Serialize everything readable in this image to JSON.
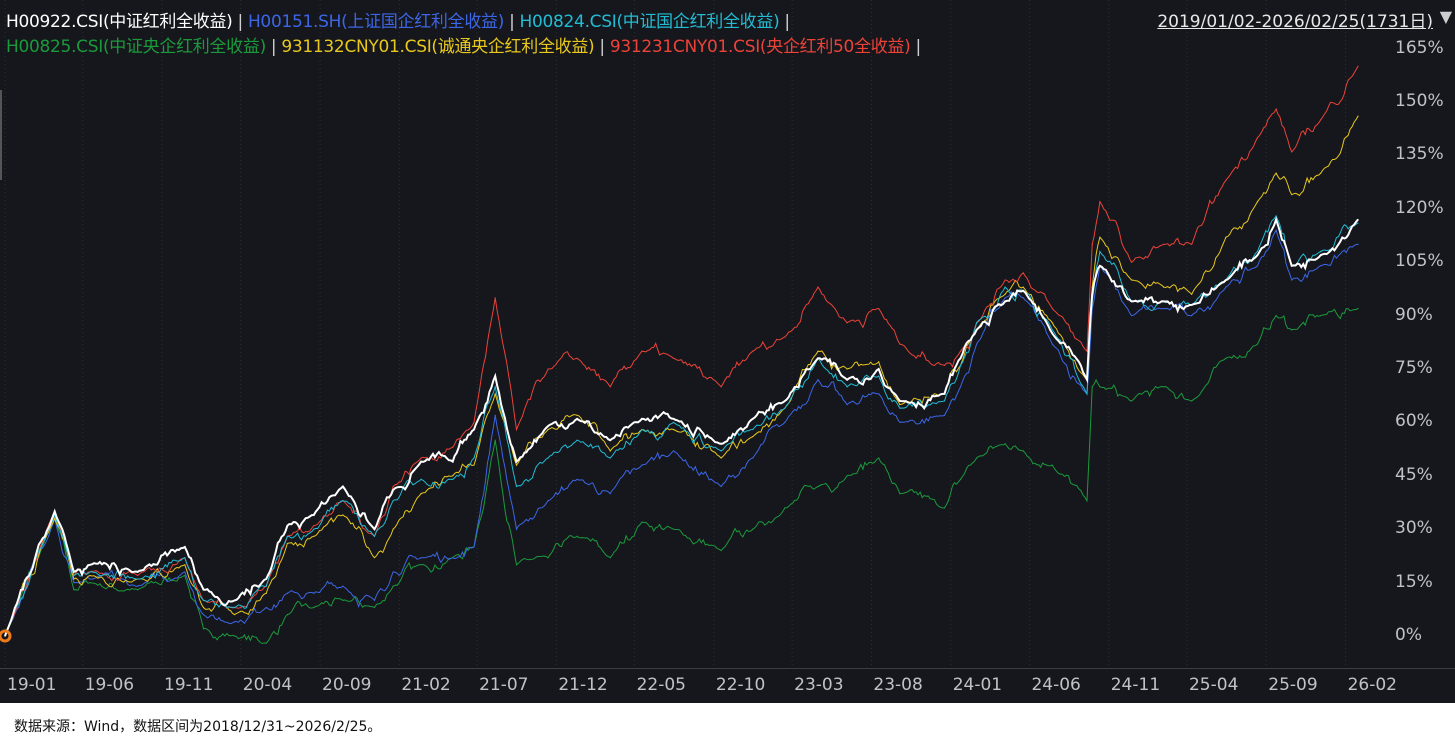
{
  "header": {
    "date_range": "2019/01/02-2026/02/25(1731日)",
    "separator": "|"
  },
  "footer": {
    "note": "数据来源：Wind，数据区间为2018/12/31~2026/2/25。"
  },
  "chart_data": {
    "type": "line",
    "title": "",
    "xlabel": "",
    "ylabel": "",
    "ylim": [
      -8,
      168
    ],
    "y_ticks": [
      "165%",
      "150%",
      "135%",
      "120%",
      "105%",
      "90%",
      "75%",
      "60%",
      "45%",
      "30%",
      "15%",
      "0%"
    ],
    "y_tick_values": [
      165,
      150,
      135,
      120,
      105,
      90,
      75,
      60,
      45,
      30,
      15,
      0
    ],
    "x_ticks": [
      "19-01",
      "19-06",
      "19-11",
      "20-04",
      "20-09",
      "21-02",
      "21-07",
      "21-12",
      "22-05",
      "22-10",
      "23-03",
      "23-08",
      "24-01",
      "24-06",
      "24-11",
      "25-04",
      "25-09",
      "26-02"
    ],
    "x_tick_dates": [
      "2019-01-02",
      "2019-06-01",
      "2019-11-01",
      "2020-04-01",
      "2020-09-01",
      "2021-02-01",
      "2021-07-01",
      "2021-12-01",
      "2022-05-01",
      "2022-10-01",
      "2023-03-01",
      "2023-08-01",
      "2024-01-01",
      "2024-06-01",
      "2024-11-01",
      "2025-04-01",
      "2025-09-01",
      "2026-02-01"
    ],
    "grid": false,
    "legend_position": "top-left",
    "x": [
      "2019-01-02",
      "2019-04-08",
      "2019-05-15",
      "2019-06-15",
      "2019-09-15",
      "2019-12-15",
      "2020-01-20",
      "2020-03-20",
      "2020-05-20",
      "2020-06-30",
      "2020-08-20",
      "2020-10-15",
      "2020-12-15",
      "2021-01-20",
      "2021-03-15",
      "2021-05-15",
      "2021-06-25",
      "2021-08-05",
      "2021-09-15",
      "2021-11-15",
      "2022-01-10",
      "2022-03-15",
      "2022-05-15",
      "2022-07-15",
      "2022-10-15",
      "2022-12-15",
      "2023-02-15",
      "2023-04-20",
      "2023-06-15",
      "2023-08-15",
      "2023-09-25",
      "2023-12-20",
      "2024-01-20",
      "2024-02-20",
      "2024-04-15",
      "2024-05-20",
      "2024-07-15",
      "2024-09-20",
      "2024-09-30",
      "2024-10-15",
      "2024-12-15",
      "2025-02-15",
      "2025-04-10",
      "2025-06-15",
      "2025-08-15",
      "2025-09-20",
      "2025-10-20",
      "2025-12-15",
      "2026-02-25"
    ],
    "series": [
      {
        "name": "H00825.CSI(中证央企红利全收益)",
        "color": "#1b9a3c",
        "line": 1,
        "values": [
          0,
          33,
          13,
          15,
          13,
          17,
          2,
          0,
          -2,
          6,
          8,
          10,
          8,
          14,
          20,
          22,
          25,
          55,
          20,
          22,
          28,
          22,
          32,
          30,
          24,
          30,
          36,
          42,
          45,
          50,
          40,
          36,
          44,
          50,
          54,
          52,
          48,
          38,
          70,
          70,
          66,
          70,
          66,
          78,
          82,
          90,
          86,
          90,
          92
        ]
      },
      {
        "name": "H00151.SH(上证国企红利全收益)",
        "color": "#3c66e6",
        "line": 0,
        "values": [
          0,
          33,
          15,
          16,
          14,
          18,
          6,
          4,
          8,
          12,
          12,
          14,
          10,
          18,
          22,
          22,
          25,
          62,
          30,
          38,
          44,
          40,
          48,
          52,
          42,
          50,
          60,
          72,
          65,
          68,
          60,
          62,
          70,
          82,
          95,
          95,
          82,
          68,
          92,
          104,
          90,
          92,
          90,
          98,
          104,
          114,
          100,
          104,
          110
        ]
      },
      {
        "name": "931132CNY01.CSI(诚通央企红利全收益)",
        "color": "#e8c81c",
        "line": 1,
        "values": [
          0,
          33,
          16,
          17,
          16,
          20,
          8,
          6,
          12,
          26,
          28,
          34,
          22,
          30,
          40,
          45,
          48,
          68,
          48,
          58,
          62,
          52,
          58,
          58,
          50,
          56,
          64,
          80,
          75,
          77,
          65,
          68,
          76,
          86,
          96,
          98,
          88,
          72,
          98,
          112,
          100,
          98,
          96,
          112,
          122,
          130,
          124,
          130,
          146
        ]
      },
      {
        "name": "931231CNY01.CSI(央企红利50全收益)",
        "color": "#ec4238",
        "line": 1,
        "values": [
          0,
          35,
          17,
          18,
          17,
          22,
          10,
          8,
          14,
          28,
          31,
          38,
          28,
          42,
          50,
          53,
          60,
          95,
          58,
          75,
          78,
          70,
          80,
          78,
          70,
          80,
          84,
          98,
          88,
          92,
          82,
          76,
          80,
          88,
          100,
          102,
          92,
          80,
          110,
          122,
          105,
          110,
          110,
          128,
          140,
          148,
          136,
          145,
          160
        ]
      },
      {
        "name": "H00824.CSI(中证国企红利全收益)",
        "color": "#22bcd4",
        "line": 0,
        "values": [
          0,
          34,
          17,
          18,
          16,
          22,
          10,
          8,
          14,
          28,
          30,
          38,
          28,
          38,
          44,
          44,
          50,
          70,
          42,
          50,
          55,
          50,
          58,
          60,
          52,
          58,
          64,
          78,
          70,
          73,
          64,
          66,
          76,
          88,
          98,
          97,
          86,
          68,
          94,
          108,
          94,
          94,
          93,
          100,
          108,
          118,
          104,
          108,
          116
        ]
      },
      {
        "name": "H00922.CSI(中证红利全收益)",
        "color": "#ffffff",
        "line": 0,
        "values": [
          0,
          35,
          18,
          20,
          18,
          25,
          13,
          10,
          16,
          31,
          34,
          42,
          30,
          41,
          49,
          49,
          58,
          73,
          49,
          59,
          61,
          55,
          61,
          61,
          54,
          61,
          66,
          78,
          72,
          75,
          66,
          68,
          78,
          86,
          94,
          97,
          85,
          72,
          96,
          104,
          94,
          94,
          93,
          100,
          107,
          117,
          104,
          107,
          117
        ]
      }
    ]
  }
}
